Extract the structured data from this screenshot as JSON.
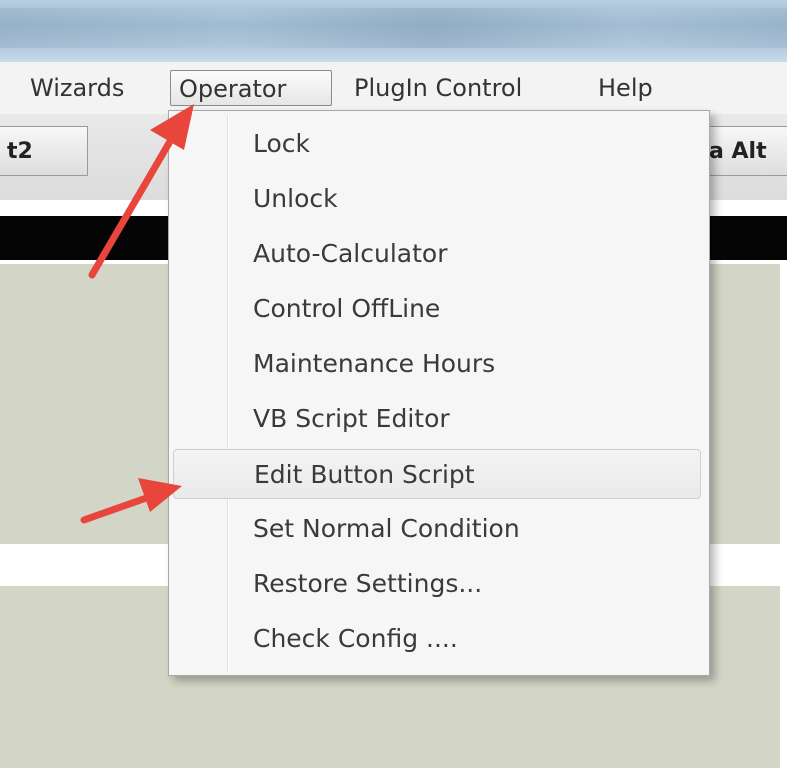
{
  "menubar": {
    "items": [
      {
        "label": "Wizards"
      },
      {
        "label": "Operator"
      },
      {
        "label": "PlugIn Control"
      },
      {
        "label": "Help"
      }
    ]
  },
  "toolbar": {
    "left_button": "t2",
    "right_button": "a Alt"
  },
  "operator_menu": {
    "items": [
      {
        "label": "Lock"
      },
      {
        "label": "Unlock"
      },
      {
        "label": "Auto-Calculator"
      },
      {
        "label": "Control OffLine"
      },
      {
        "label": "Maintenance Hours"
      },
      {
        "label": "VB Script Editor"
      },
      {
        "label": "Edit Button Script",
        "highlighted": true
      },
      {
        "label": "Set Normal Condition"
      },
      {
        "label": "Restore Settings..."
      },
      {
        "label": "Check Config ...."
      }
    ]
  },
  "annotations": {
    "arrow_color": "#e8453c",
    "accent_highlight": "#e9e9e9"
  }
}
